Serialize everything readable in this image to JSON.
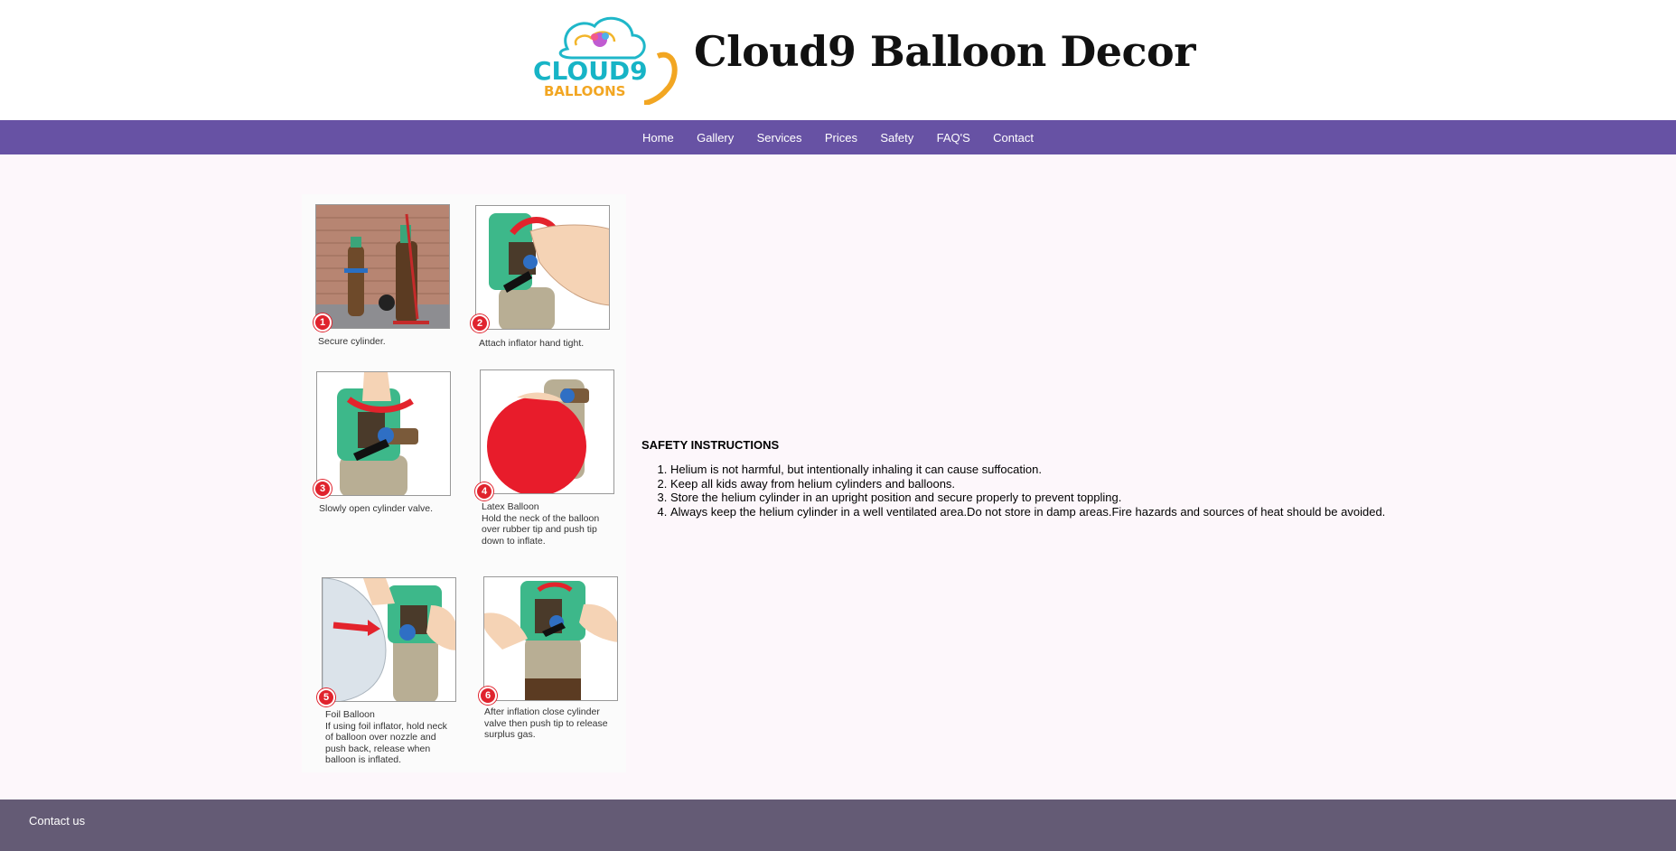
{
  "header": {
    "logo": {
      "line1": "CLOUD9",
      "line2": "BALLOONS"
    },
    "title": "Cloud9 Balloon Decor"
  },
  "nav": {
    "items": [
      "Home",
      "Gallery",
      "Services",
      "Prices",
      "Safety",
      "FAQ'S",
      "Contact"
    ]
  },
  "instructions_image": {
    "steps": [
      {
        "number": "1",
        "caption": "Secure cylinder."
      },
      {
        "number": "2",
        "caption": "Attach inflator hand tight."
      },
      {
        "number": "3",
        "caption": "Slowly open cylinder valve."
      },
      {
        "number": "4",
        "caption": "Latex Balloon\nHold the neck of the balloon\nover rubber tip and push tip\ndown to inflate."
      },
      {
        "number": "5",
        "caption": "Foil Balloon\nIf using foil inflator, hold neck\nof balloon over nozzle and\npush back, release when\nballoon is inflated."
      },
      {
        "number": "6",
        "caption": "After inflation close cylinder\nvalve then push tip to release\nsurplus gas."
      }
    ]
  },
  "safety": {
    "heading": "SAFETY INSTRUCTIONS",
    "items": [
      "Helium is not harmful, but intentionally inhaling it can cause suffocation.",
      "Keep all kids away from helium cylinders and balloons.",
      "Store the helium cylinder in an upright position and secure properly to prevent toppling.",
      "Always keep the helium cylinder in a well ventilated area.Do not store in damp areas.Fire hazards and sources of heat should be avoided."
    ]
  },
  "footer": {
    "contact_label": "Contact us"
  },
  "colors": {
    "nav": "#6752a4",
    "footer": "#645b75",
    "badge": "#e0232d",
    "cylinder_green": "#3db88a"
  }
}
